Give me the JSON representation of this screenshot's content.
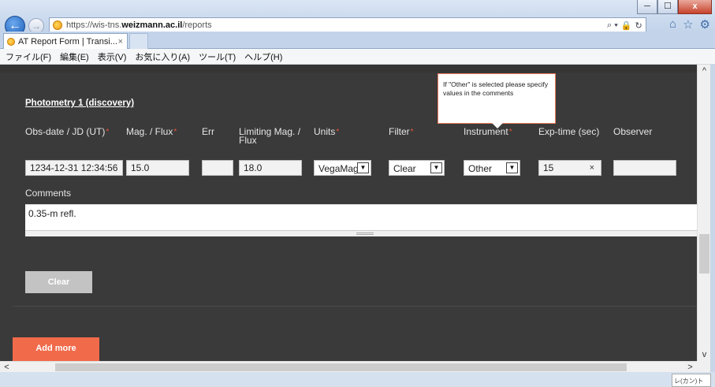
{
  "browser": {
    "url_scheme": "https://wis-tns.",
    "url_domain": "weizmann.ac.il",
    "url_path": "/reports",
    "tab_title": "AT Report Form | Transi...",
    "tab_close": "×",
    "window_min": "─",
    "window_max": "☐",
    "window_close": "x",
    "search_glyph": "⌕ ▾",
    "lock_glyph": "🔒",
    "refresh_glyph": "↻",
    "home_glyph": "⌂",
    "star_glyph": "☆",
    "gear_glyph": "⚙",
    "back_glyph": "←",
    "fwd_glyph": "→"
  },
  "menu": [
    "ファイル(F)",
    "編集(E)",
    "表示(V)",
    "お気に入り(A)",
    "ツール(T)",
    "ヘルプ(H)"
  ],
  "form": {
    "section_title": "Photometry 1 (discovery)",
    "tooltip": "If \"Other\" is selected please specify values in the comments",
    "required_mark": "*",
    "labels": {
      "obsdate": "Obs-date / JD (UT)",
      "mag": "Mag. / Flux",
      "err": "Err",
      "limmag": "Limiting Mag. / Flux",
      "units": "Units",
      "filter": "Filter",
      "instrument": "Instrument",
      "exptime": "Exp-time (sec)",
      "observer": "Observer"
    },
    "values": {
      "obsdate": "1234-12-31 12:34:56",
      "mag": "15.0",
      "err": "",
      "limmag": "18.0",
      "units": "VegaMag",
      "filter": "Clear",
      "instrument": "Other",
      "exptime": "15",
      "observer": ""
    },
    "exptime_clear": "×",
    "select_caret": "▼",
    "comments_label": "Comments",
    "comments_value": "0.35-m refl.",
    "clear_button": "Clear",
    "add_more_button": "Add more"
  },
  "scroll": {
    "up": "^",
    "down": "v",
    "left": "<",
    "right": ">"
  },
  "taskbar_peek": "レ(カン)ト"
}
